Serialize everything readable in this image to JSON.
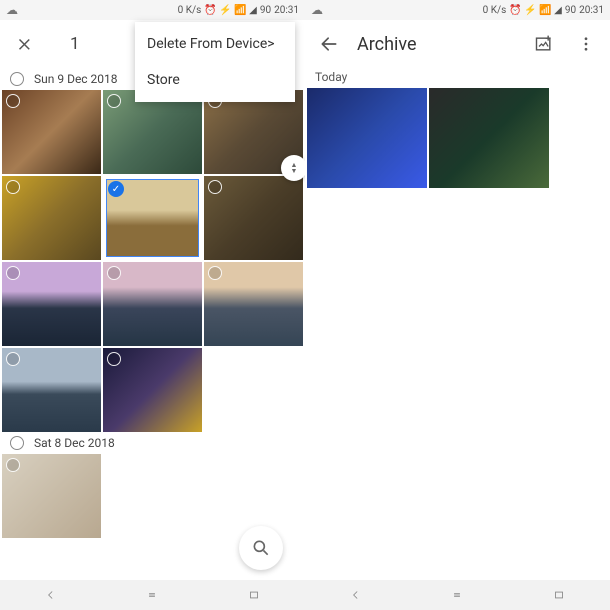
{
  "status": {
    "net_speed": "0 K/s",
    "battery": "90",
    "time": "20:31"
  },
  "left_screen": {
    "selection_count": "1",
    "menu": {
      "item1": "Delete From Device>",
      "item2": "Store"
    },
    "section1_date": "Sun 9 Dec 2018",
    "section2_date": "Sat 8 Dec 2018"
  },
  "right_screen": {
    "title": "Archive",
    "subheader": "Today"
  }
}
